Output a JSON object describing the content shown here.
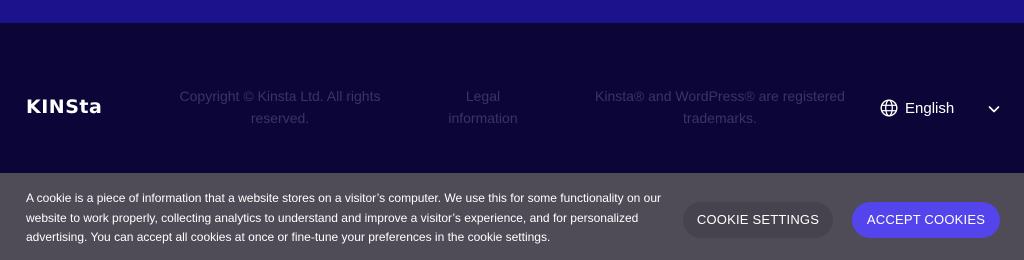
{
  "footer": {
    "logo_text": "KINSta",
    "copyright": "Copyright © Kinsta Ltd. All rights reserved.",
    "legal": "Legal information",
    "trademarks": "Kinsta® and WordPress® are registered trademarks.",
    "language": {
      "label": "English",
      "icon": "globe-icon",
      "chevron_icon": "chevron-down-icon"
    }
  },
  "cookie_banner": {
    "text": "A cookie is a piece of information that a website stores on a visitor’s computer. We use this for some functionality on our website to work properly, collecting analytics to understand and improve a visitor’s experience, and for personalized advertising. You can accept all cookies at once or fine-tune your preferences in the cookie settings.",
    "settings_label": "COOKIE SETTINGS",
    "accept_label": "ACCEPT COOKIES"
  },
  "colors": {
    "top_band": "#1c128c",
    "footer_bg": "#0c0638",
    "cookie_bg": "#4f4b57",
    "accept_button": "#5344ec"
  }
}
